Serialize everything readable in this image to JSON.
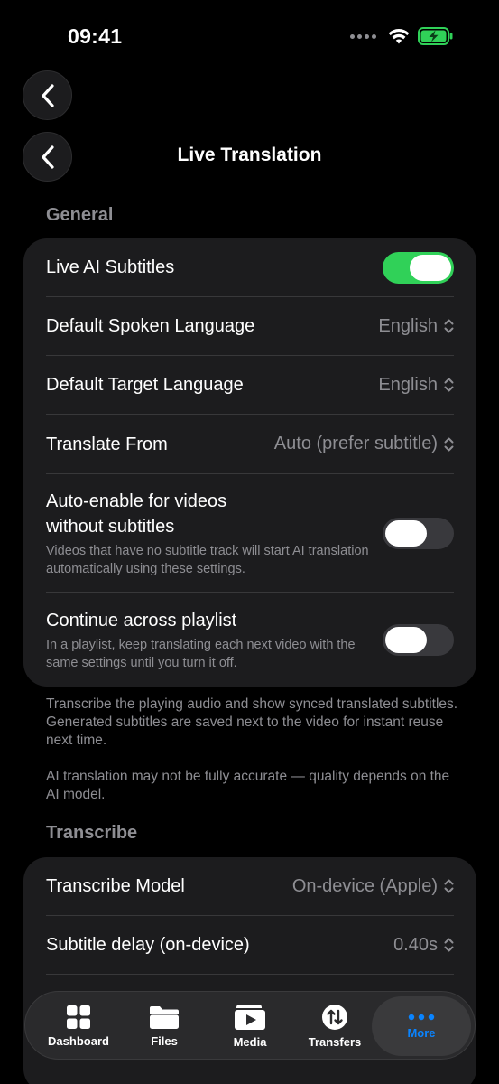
{
  "status_bar": {
    "time": "09:41"
  },
  "nav": {
    "title": "Live Translation"
  },
  "general": {
    "section_title": "General",
    "rows": [
      {
        "label": "Live AI Subtitles",
        "toggle": true
      },
      {
        "label": "Default Spoken Language",
        "value": "English"
      },
      {
        "label": "Default Target Language",
        "value": "English"
      },
      {
        "label": "Translate From",
        "value": "Auto (prefer subtitle)"
      },
      {
        "label_line1": "Auto-enable for videos",
        "label_line2": "without subtitles",
        "description": "Videos that have no subtitle track will start AI translation automatically using these settings.",
        "toggle": false
      },
      {
        "label": "Continue across playlist",
        "description": "In a playlist, keep translating each next video with the same settings until you turn it off.",
        "toggle": false
      }
    ],
    "footer_1": "Transcribe the playing audio and show synced translated subtitles. Generated subtitles are saved next to the video for instant reuse next time.",
    "footer_2": "AI translation may not be fully accurate — quality depends on the AI model."
  },
  "transcribe": {
    "section_title": "Transcribe",
    "rows": [
      {
        "label": "Transcribe Model",
        "value": "On-device (Apple)"
      },
      {
        "label": "Subtitle delay (on-device)",
        "value": "0.40s"
      }
    ]
  },
  "tab_bar": {
    "tabs": [
      {
        "label": "Dashboard",
        "icon": "grid-icon"
      },
      {
        "label": "Files",
        "icon": "folder-icon"
      },
      {
        "label": "Media",
        "icon": "media-play-icon"
      },
      {
        "label": "Transfers",
        "icon": "transfer-arrows-icon"
      },
      {
        "label": "More",
        "icon": "ellipsis-icon"
      }
    ],
    "active": "More"
  },
  "colors": {
    "accent": "#0a84ff",
    "toggle_on": "#30d158",
    "card": "#1c1c1e",
    "secondary_text": "#8e8e93"
  }
}
